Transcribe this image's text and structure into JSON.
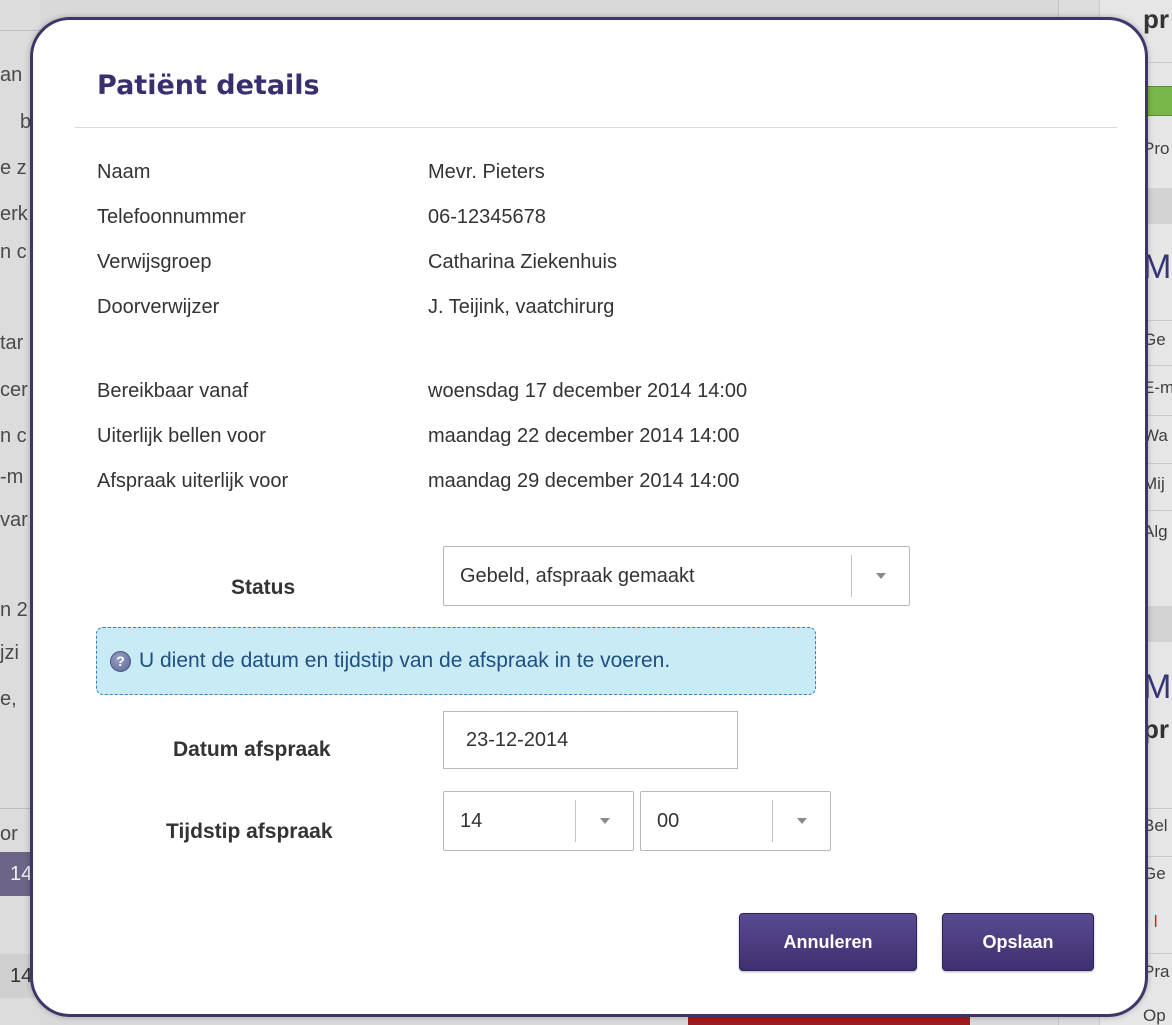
{
  "modal": {
    "title": "Patiënt details"
  },
  "patient": {
    "rows": [
      {
        "label": "Naam",
        "value": "Mevr. Pieters"
      },
      {
        "label": "Telefoonnummer",
        "value": "06-12345678"
      },
      {
        "label": "Verwijsgroep",
        "value": "Catharina Ziekenhuis"
      },
      {
        "label": "Doorverwijzer",
        "value": "J. Teijink, vaatchirurg"
      }
    ],
    "dates": [
      {
        "label": "Bereikbaar vanaf",
        "value": "woensdag 17 december 2014 14:00"
      },
      {
        "label": "Uiterlijk bellen voor",
        "value": "maandag 22 december 2014 14:00"
      },
      {
        "label": "Afspraak uiterlijk voor",
        "value": "maandag 29 december 2014 14:00"
      }
    ]
  },
  "form": {
    "status_label": "Status",
    "status_value": "Gebeld, afspraak gemaakt",
    "info_message": "U dient de datum en tijdstip van de afspraak in te voeren.",
    "datum_label": "Datum afspraak",
    "datum_value": "23-12-2014",
    "tijdstip_label": "Tijdstip afspraak",
    "hour_value": "14",
    "minute_value": "00"
  },
  "buttons": {
    "cancel": "Annuleren",
    "save": "Opslaan"
  },
  "background": {
    "left_fragments": [
      "an",
      "b",
      "e z",
      "erk",
      "n c",
      "tar",
      "cer",
      "n c",
      "-m",
      "var",
      "n 2",
      "jzi",
      "e,",
      "or"
    ],
    "left_rows": [
      "14",
      "14"
    ],
    "right_fragments": [
      "pr",
      "Pro",
      "M",
      "Ge",
      "E-m",
      "Wa",
      "Mij",
      "Alg",
      "M",
      "pr",
      "Bel",
      "Ge",
      "l",
      "Pra",
      "Op"
    ]
  },
  "colors": {
    "brand_purple": "#3a2f6e",
    "button_purple": "#4b3c80",
    "info_bg": "#c8ebf6",
    "info_border": "#3d7fb3"
  }
}
